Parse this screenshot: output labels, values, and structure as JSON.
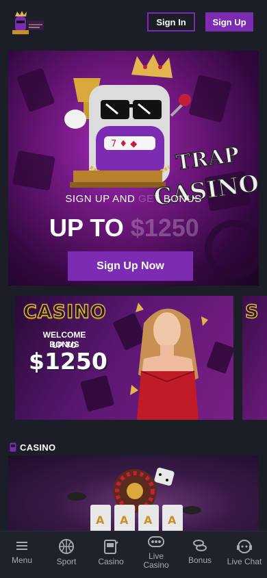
{
  "header": {
    "sign_in_label": "Sign In",
    "sign_up_label": "Sign Up"
  },
  "hero": {
    "subtitle_a": "SIGN UP AND ",
    "subtitle_b": "GET",
    "subtitle_c": " BONUS",
    "amount_a": "UP TO ",
    "amount_b": "$1250",
    "cta_label": "Sign Up Now",
    "logo_text_1": "TRAP",
    "logo_text_2": "CASINO"
  },
  "promos": [
    {
      "title": "CASINO",
      "line1": "WELCOME BONUS",
      "line2": "UP TO",
      "amount": "$1250"
    },
    {
      "title": "S"
    }
  ],
  "section": {
    "label": "CASINO"
  },
  "nav": {
    "items": [
      {
        "label": "Menu",
        "icon": "menu-icon"
      },
      {
        "label": "Sport",
        "icon": "basketball-icon"
      },
      {
        "label": "Casino",
        "icon": "slot-machine-icon"
      },
      {
        "label": "Live Casino",
        "icon": "live-table-icon"
      },
      {
        "label": "Bonus",
        "icon": "coins-icon"
      },
      {
        "label": "Live Chat",
        "icon": "chat-support-icon"
      }
    ]
  },
  "colors": {
    "background": "#1b1e26",
    "accent": "#7b2cb3",
    "nav_text": "#a9acb5"
  }
}
